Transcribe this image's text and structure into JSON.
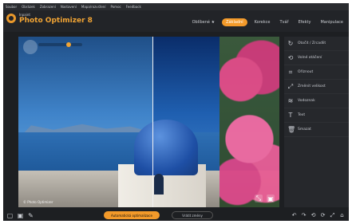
{
  "menubar": {
    "items": [
      "Soubor",
      "Obrázek",
      "Zobrazení",
      "Nastavení",
      "Mapa/rozvržení",
      "Pomoc",
      "Feedback"
    ]
  },
  "app": {
    "brand_small": "Inpaint",
    "brand_big": "Photo Optimizer 8"
  },
  "tabs": [
    {
      "label": "Oblíbené ★"
    },
    {
      "label": "Základní"
    },
    {
      "label": "Korekce"
    },
    {
      "label": "Tvář"
    },
    {
      "label": "Efekty"
    },
    {
      "label": "Manipulace"
    }
  ],
  "panel": {
    "items": [
      {
        "icon": "rotate-icon",
        "label": "Otočit / Zrcadlit"
      },
      {
        "icon": "straighten-icon",
        "label": "Volné otáčení"
      },
      {
        "icon": "crop-icon",
        "label": "Oříznout"
      },
      {
        "icon": "resize-icon",
        "label": "Změnit velikost"
      },
      {
        "icon": "watermark-icon",
        "label": "Vodoznak"
      },
      {
        "icon": "text-icon",
        "label": "Text"
      },
      {
        "icon": "delete-icon",
        "label": "Smazat"
      }
    ]
  },
  "stage": {
    "caption": "© Photo Optimizer",
    "tool_1": "⤡",
    "tool_2": "▣"
  },
  "bottombar": {
    "optimize_label": "Automatická optimalizace",
    "undo_label": "Vrátit změny",
    "left_icons": [
      "▢",
      "▣",
      "✎"
    ],
    "right_icons": [
      "↶",
      "↷",
      "⟲",
      "⟳",
      "⤢",
      "⌂"
    ]
  },
  "colors": {
    "accent": "#f39a2a",
    "panel": "#26282c",
    "background": "#1d1f22"
  }
}
